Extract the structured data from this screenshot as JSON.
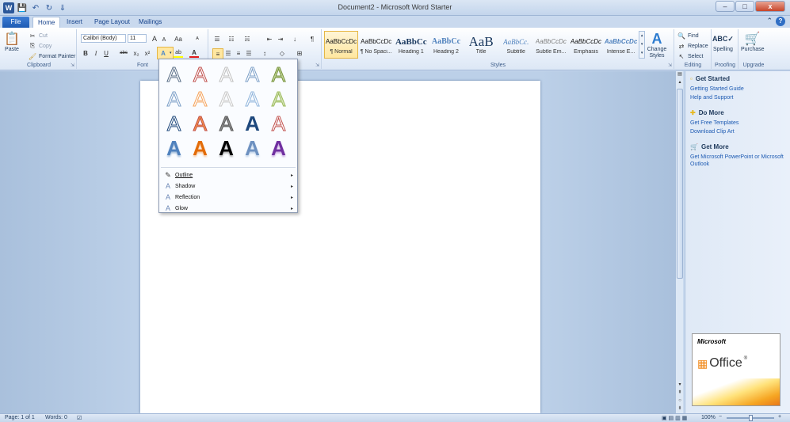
{
  "window": {
    "title": "Document2 - Microsoft Word Starter",
    "minimize": "–",
    "restore": "□",
    "close": "x"
  },
  "qat": {
    "logo": "W",
    "save": "💾",
    "undo": "↶",
    "redo": "↻",
    "customize": "⇓"
  },
  "tabs": {
    "file": "File",
    "home": "Home",
    "insert": "Insert",
    "page_layout": "Page Layout",
    "mailings": "Mailings",
    "minimize_ribbon": "⌃",
    "help": "?"
  },
  "clipboard": {
    "paste": "Paste",
    "cut": "Cut",
    "copy": "Copy",
    "format_painter": "Format Painter",
    "label": "Clipboard"
  },
  "font": {
    "name": "Calibri (Body)",
    "size": "11",
    "grow": "A",
    "shrink": "A",
    "change_case": "Aa",
    "clear": "ᴬ",
    "bold": "B",
    "italic": "I",
    "underline": "U",
    "strike": "abc",
    "subscript": "x₂",
    "superscript": "x²",
    "text_effects": "A",
    "highlight": "ab",
    "font_color": "A",
    "label": "Font"
  },
  "paragraph": {
    "bullets": "☰",
    "numbering": "☷",
    "multilevel": "☵",
    "decrease_indent": "⇤",
    "increase_indent": "⇥",
    "sort": "↓",
    "pilcrow": "¶",
    "align_left": "≡",
    "center": "☰",
    "align_right": "≡",
    "justify": "☰",
    "line_spacing": "↕",
    "shading": "◇",
    "borders": "⊞",
    "label": "Paragraph"
  },
  "styles": {
    "items": [
      {
        "preview": "AaBbCcDc",
        "name": "¶ Normal"
      },
      {
        "preview": "AaBbCcDc",
        "name": "¶ No Spaci..."
      },
      {
        "preview": "AaBbCc",
        "name": "Heading 1"
      },
      {
        "preview": "AaBbCc",
        "name": "Heading 2"
      },
      {
        "preview": "AaB",
        "name": "Title"
      },
      {
        "preview": "AaBbCc.",
        "name": "Subtitle"
      },
      {
        "preview": "AaBbCcDc",
        "name": "Subtle Em..."
      },
      {
        "preview": "AaBbCcDc",
        "name": "Emphasis"
      },
      {
        "preview": "AaBbCcDc",
        "name": "Intense E..."
      }
    ],
    "change_styles": "Change Styles",
    "label": "Styles"
  },
  "editing": {
    "find": "Find",
    "replace": "Replace",
    "select": "Select",
    "label": "Editing"
  },
  "proofing": {
    "spelling": "Spelling",
    "label": "Proofing"
  },
  "upgrade": {
    "purchase": "Purchase",
    "label": "Upgrade"
  },
  "text_effects_menu": {
    "glyph": "A",
    "items": [
      {
        "label": "Outline",
        "icon": "✎"
      },
      {
        "label": "Shadow",
        "icon": "A"
      },
      {
        "label": "Reflection",
        "icon": "A"
      },
      {
        "label": "Glow",
        "icon": "A"
      }
    ],
    "arrow": "▸"
  },
  "taskpane": {
    "get_started": {
      "heading": "Get Started",
      "links": [
        "Getting Started Guide",
        "Help and Support"
      ]
    },
    "do_more": {
      "heading": "Do More",
      "links": [
        "Get Free Templates",
        "Download Clip Art"
      ]
    },
    "get_more": {
      "heading": "Get More",
      "links": [
        "Get Microsoft PowerPoint or Microsoft Outlook"
      ]
    },
    "ad": {
      "microsoft": "Microsoft",
      "office": "Office",
      "reg": "®"
    }
  },
  "status": {
    "page": "Page: 1 of 1",
    "words": "Words: 0",
    "zoom": "100%",
    "zoom_out": "−",
    "zoom_in": "+"
  },
  "colors": {
    "accent": "#2b579a",
    "ribbon_bg": "#e6eef9",
    "doc_bg": "#bcd0e8",
    "link": "#1e5bb3"
  }
}
